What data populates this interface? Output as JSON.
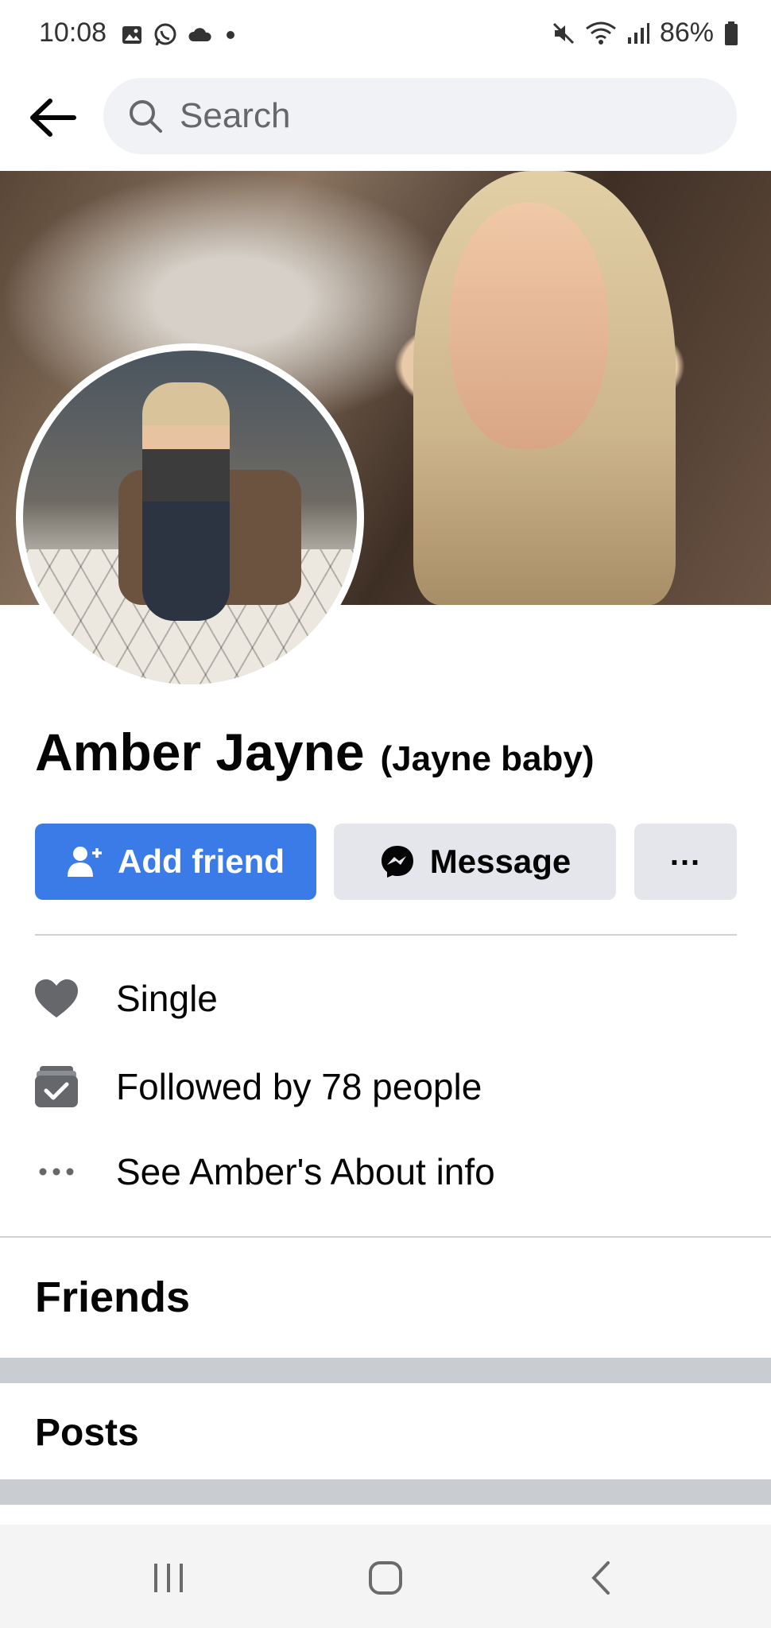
{
  "status_bar": {
    "time": "10:08",
    "battery": "86%",
    "left_icons": [
      "gallery-icon",
      "whatsapp-icon",
      "cloud-icon",
      "dot-icon"
    ],
    "right_icons": [
      "mute-icon",
      "wifi-icon",
      "signal-icon",
      "battery-icon"
    ]
  },
  "search": {
    "placeholder": "Search"
  },
  "profile": {
    "name": "Amber Jayne",
    "nickname": "(Jayne baby)"
  },
  "actions": {
    "add_friend": "Add friend",
    "message": "Message",
    "more": "..."
  },
  "info": {
    "relationship": "Single",
    "followers": "Followed by 78 people",
    "about": "See Amber's About info"
  },
  "sections": {
    "friends": "Friends",
    "posts": "Posts"
  },
  "colors": {
    "accent": "#3b7be7",
    "secondary_button": "#e4e6eb",
    "search_bg": "#f0f2f5",
    "band": "#c9ccd1"
  }
}
